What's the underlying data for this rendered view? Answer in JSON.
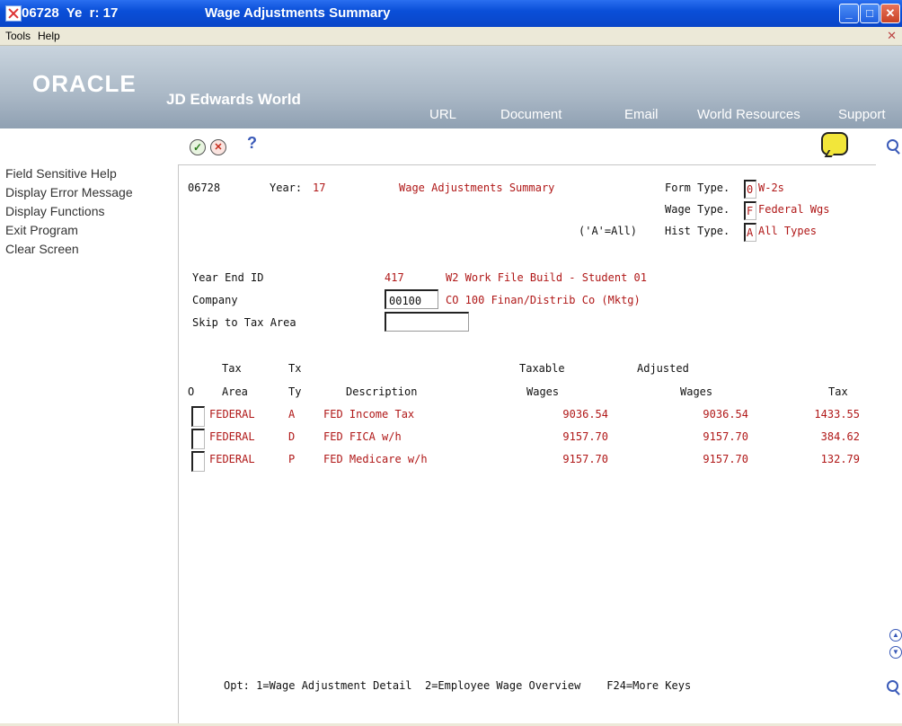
{
  "window": {
    "left_text": "06728  Ye  r: 17",
    "title": "Wage Adjustments Summary"
  },
  "menu": {
    "tools": "Tools",
    "help": "Help"
  },
  "banner": {
    "brand": "ORACLE",
    "product": "JD Edwards World",
    "nav": [
      "URL",
      "Document",
      "Email",
      "World Resources",
      "Support"
    ]
  },
  "sidebar": {
    "items": [
      "Field Sensitive Help",
      "Display Error Message",
      "Display Functions",
      "Exit Program",
      "Clear Screen"
    ]
  },
  "toolbar": {
    "help_glyph": "?"
  },
  "header": {
    "program": "06728",
    "year_label": "Year:",
    "year_value": "17",
    "title": "Wage Adjustments Summary",
    "form_type_label": "Form Type.",
    "form_type_value": "0",
    "form_type_desc": "W-2s",
    "wage_type_label": "Wage Type.",
    "wage_type_value": "F",
    "wage_type_desc": "Federal Wgs",
    "all_hint": "('A'=All)",
    "hist_type_label": "Hist Type.",
    "hist_type_value": "A",
    "hist_type_desc": "All Types"
  },
  "fields": {
    "year_end_label": "Year End ID",
    "year_end_value": "417",
    "year_end_desc": "W2 Work File Build - Student 01",
    "company_label": "Company",
    "company_value": "00100",
    "company_desc": "CO 100 Finan/Distrib Co (Mktg)",
    "skip_label": "Skip to Tax Area",
    "skip_value": ""
  },
  "table": {
    "headers_top": {
      "tax": "Tax",
      "tx": "Tx",
      "taxable": "Taxable",
      "adjusted": "Adjusted"
    },
    "headers": {
      "o": "O",
      "area": "Area",
      "ty": "Ty",
      "description": "Description",
      "wages": "Wages",
      "adj_wages": "Wages",
      "tax": "Tax"
    },
    "rows": [
      {
        "area": "FEDERAL",
        "ty": "A",
        "description": "FED Income Tax",
        "taxable": "9036.54",
        "adjusted": "9036.54",
        "tax": "1433.55"
      },
      {
        "area": "FEDERAL",
        "ty": "D",
        "description": "FED FICA w/h",
        "taxable": "9157.70",
        "adjusted": "9157.70",
        "tax": "384.62"
      },
      {
        "area": "FEDERAL",
        "ty": "P",
        "description": "FED Medicare w/h",
        "taxable": "9157.70",
        "adjusted": "9157.70",
        "tax": "132.79"
      }
    ]
  },
  "footer": {
    "keys": "Opt: 1=Wage Adjustment Detail  2=Employee Wage Overview    F24=More Keys"
  },
  "icons": {
    "ok": "check-circle-icon",
    "cancel": "x-circle-icon",
    "help": "question-icon",
    "note": "speech-bubble-icon",
    "search": "search-icon"
  }
}
